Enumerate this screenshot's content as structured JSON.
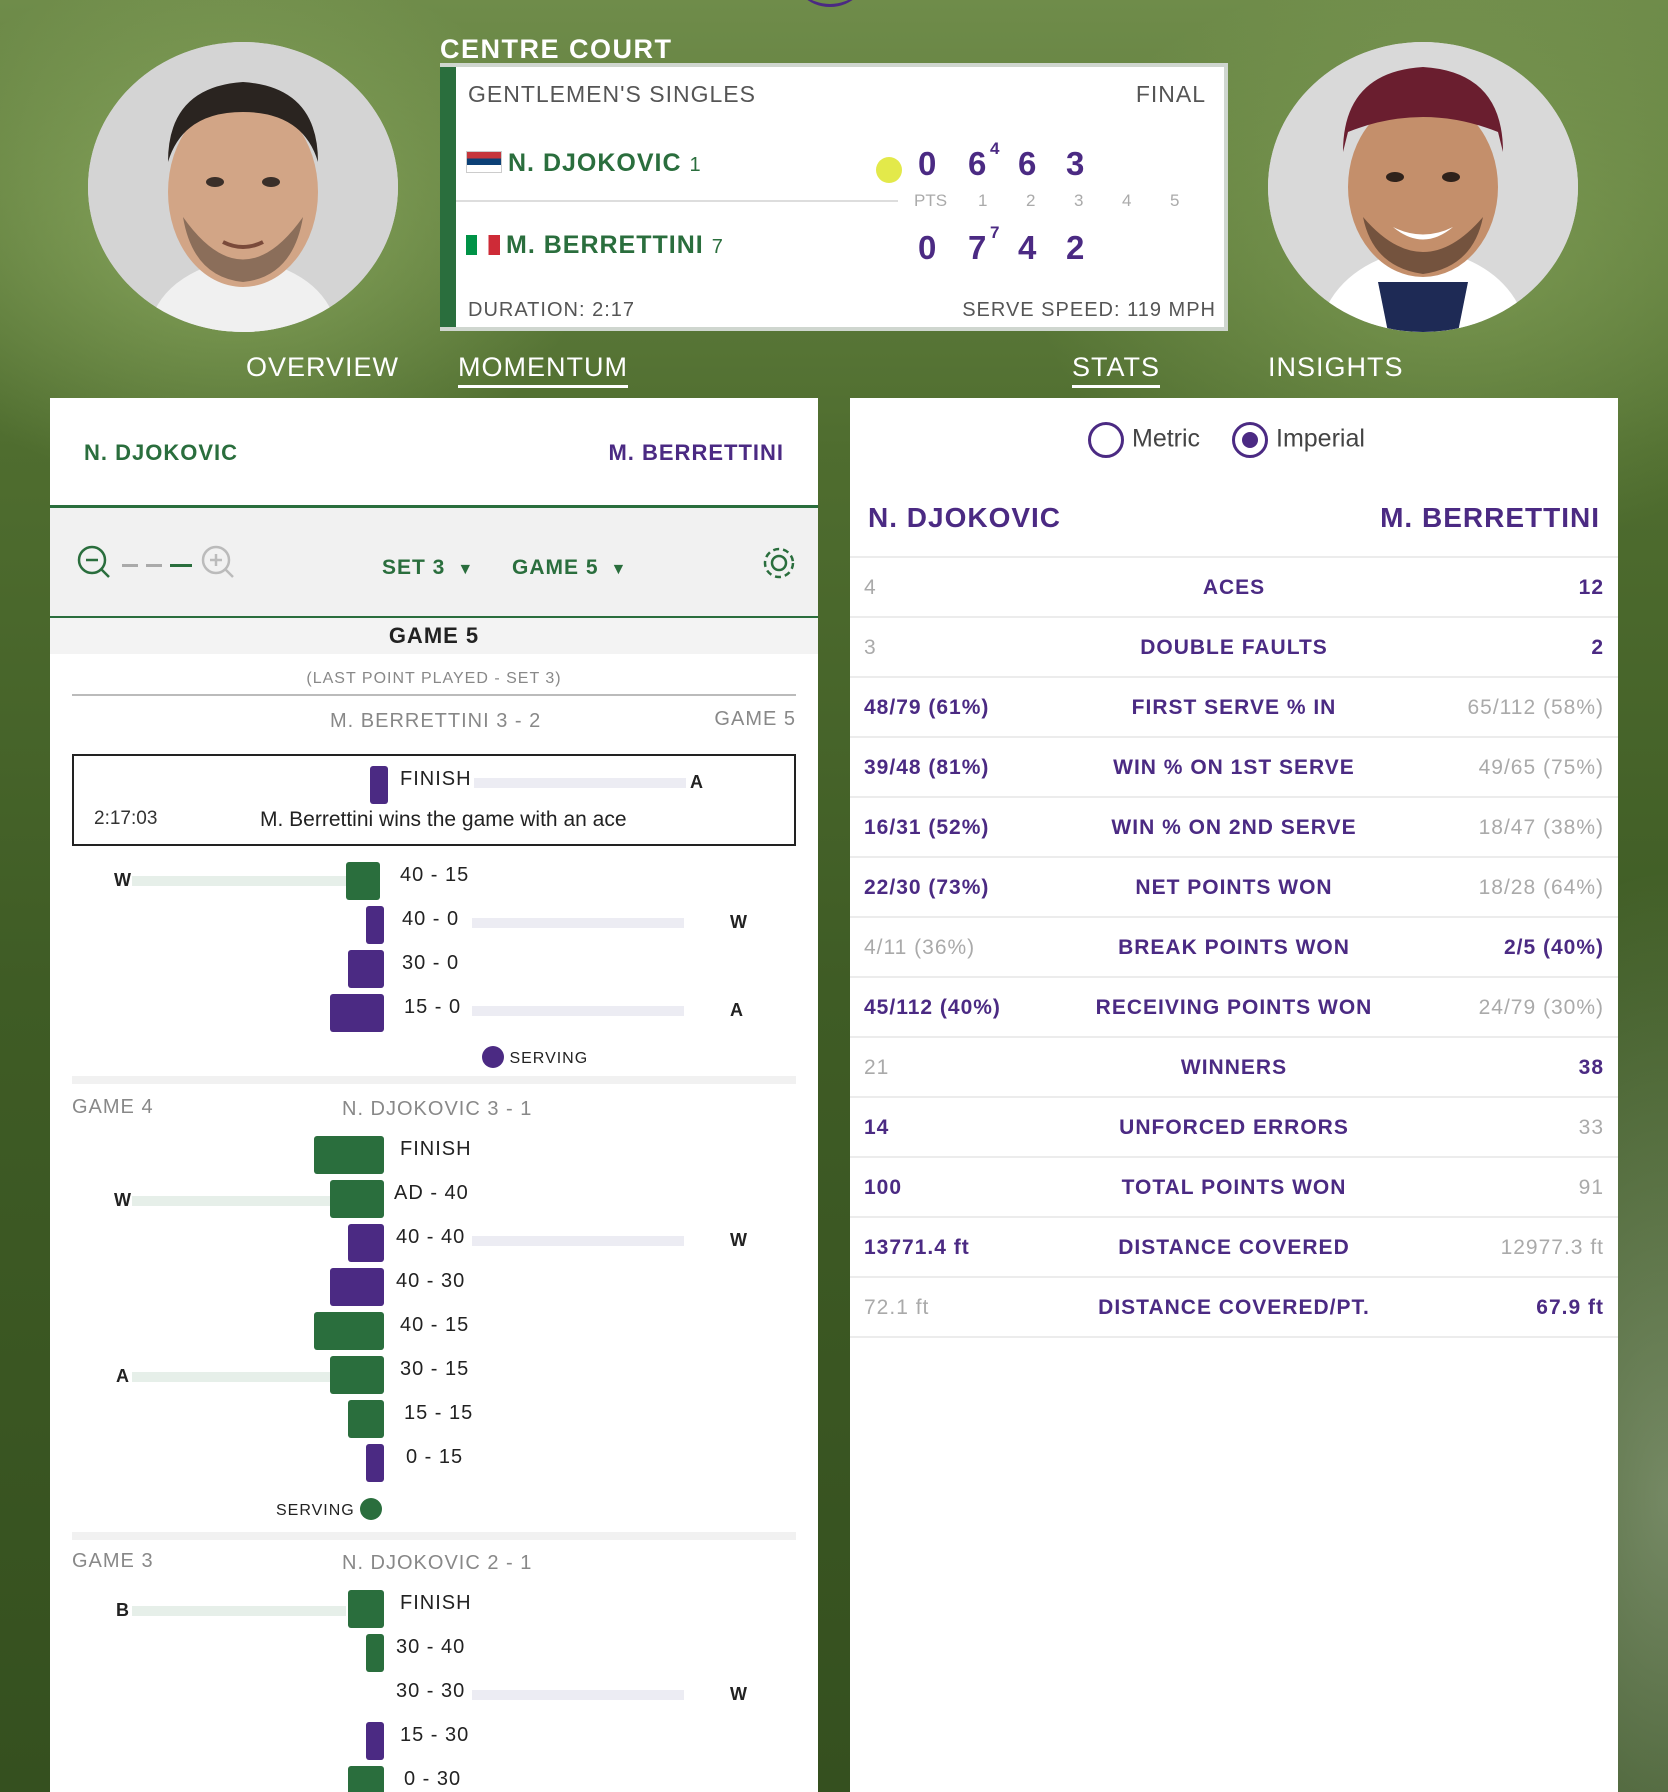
{
  "match": {
    "court": "CENTRE COURT",
    "event": "GENTLEMEN'S SINGLES",
    "round": "FINAL",
    "duration": "DURATION: 2:17",
    "serve_speed": "SERVE SPEED: 119 MPH",
    "player1": {
      "name": "N. DJOKOVIC",
      "seed": "1",
      "flag": "serbia-flag",
      "pts": "0",
      "s1": "6",
      "s1_tb": "4",
      "s2": "6",
      "s3": "3"
    },
    "player2": {
      "name": "M. BERRETTINI",
      "seed": "7",
      "flag": "italy-flag",
      "pts": "0",
      "s1": "7",
      "s1_tb": "7",
      "s2": "4",
      "s3": "2"
    },
    "columns": [
      "PTS",
      "1",
      "2",
      "3",
      "4",
      "5"
    ]
  },
  "tabs": [
    "OVERVIEW",
    "MOMENTUM",
    "STATS",
    "INSIGHTS"
  ],
  "momentum": {
    "player1": "N. DJOKOVIC",
    "player2": "M. BERRETTINI",
    "set_select": "SET 3",
    "game_select": "GAME 5",
    "current_game_title": "GAME 5",
    "last_point_note": "(LAST POINT PLAYED - SET 3)",
    "game5": {
      "score": "M. BERRETTINI 3 - 2",
      "label": "GAME 5",
      "finish_label": "FINISH",
      "finish_time": "2:17:03",
      "finish_text": "M. Berrettini wins the game with an ace",
      "finish_letter": "A",
      "rows": [
        {
          "score": "40 - 15",
          "end": "W"
        },
        {
          "score": "40 - 0",
          "end": "W"
        },
        {
          "score": "30 - 0",
          "end": ""
        },
        {
          "score": "15 - 0",
          "end": "A"
        }
      ],
      "serving": "SERVING"
    },
    "game4": {
      "label": "GAME 4",
      "score": "N. DJOKOVIC 3 - 1",
      "rows": [
        {
          "score": "FINISH",
          "end": ""
        },
        {
          "score": "AD - 40",
          "end": "W"
        },
        {
          "score": "40 - 40",
          "end": "W"
        },
        {
          "score": "40 - 30",
          "end": ""
        },
        {
          "score": "40 - 15",
          "end": ""
        },
        {
          "score": "30 - 15",
          "end": "A"
        },
        {
          "score": "15 - 15",
          "end": ""
        },
        {
          "score": "0 - 15",
          "end": ""
        }
      ],
      "serving": "SERVING"
    },
    "game3": {
      "label": "GAME 3",
      "score": "N. DJOKOVIC 2 - 1",
      "rows": [
        {
          "score": "FINISH",
          "end": "B"
        },
        {
          "score": "30 - 40",
          "end": ""
        },
        {
          "score": "30 - 30",
          "end": "W"
        },
        {
          "score": "15 - 30",
          "end": ""
        },
        {
          "score": "0 - 30",
          "end": ""
        }
      ]
    }
  },
  "stats": {
    "units": {
      "metric": "Metric",
      "imperial": "Imperial",
      "selected": "imperial"
    },
    "player1": "N. DJOKOVIC",
    "player2": "M. BERRETTINI",
    "rows": [
      {
        "left": "4",
        "label": "ACES",
        "right": "12",
        "leader": "right"
      },
      {
        "left": "3",
        "label": "DOUBLE FAULTS",
        "right": "2",
        "leader": "right"
      },
      {
        "left": "48/79 (61%)",
        "label": "FIRST SERVE % IN",
        "right": "65/112 (58%)",
        "leader": "left"
      },
      {
        "left": "39/48 (81%)",
        "label": "WIN % ON 1ST SERVE",
        "right": "49/65 (75%)",
        "leader": "left"
      },
      {
        "left": "16/31 (52%)",
        "label": "WIN % ON 2ND SERVE",
        "right": "18/47 (38%)",
        "leader": "left"
      },
      {
        "left": "22/30 (73%)",
        "label": "NET POINTS WON",
        "right": "18/28 (64%)",
        "leader": "left"
      },
      {
        "left": "4/11 (36%)",
        "label": "BREAK POINTS WON",
        "right": "2/5 (40%)",
        "leader": "right"
      },
      {
        "left": "45/112 (40%)",
        "label": "RECEIVING POINTS WON",
        "right": "24/79 (30%)",
        "leader": "left"
      },
      {
        "left": "21",
        "label": "WINNERS",
        "right": "38",
        "leader": "right"
      },
      {
        "left": "14",
        "label": "UNFORCED ERRORS",
        "right": "33",
        "leader": "left"
      },
      {
        "left": "100",
        "label": "TOTAL POINTS WON",
        "right": "91",
        "leader": "left"
      },
      {
        "left": "13771.4 ft",
        "label": "DISTANCE COVERED",
        "right": "12977.3 ft",
        "leader": "left"
      },
      {
        "left": "72.1 ft",
        "label": "DISTANCE COVERED/PT.",
        "right": "67.9 ft",
        "leader": "right"
      }
    ]
  },
  "colors": {
    "green": "#2a6e3d",
    "purple": "#4b2a83",
    "ball": "#e3e94a"
  }
}
